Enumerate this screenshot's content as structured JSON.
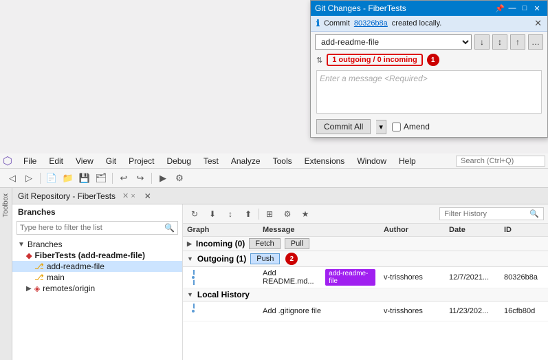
{
  "window": {
    "title": "Git Changes - FiberTests"
  },
  "git_changes": {
    "title": "Git Changes - FiberTests",
    "info_text": "Commit ",
    "commit_hash": "80326b8a",
    "info_suffix": " created locally.",
    "branch_name": "add-readme-file",
    "sync_label": "1 outgoing / 0 incoming",
    "message_placeholder": "Enter a message <Required>",
    "commit_all_label": "Commit All",
    "amend_label": "Amend",
    "badge_number": "1"
  },
  "menu": {
    "items": [
      "File",
      "Edit",
      "View",
      "Git",
      "Project",
      "Debug",
      "Test",
      "Analyze",
      "Tools",
      "Extensions",
      "Window",
      "Help"
    ],
    "search_placeholder": "Search (Ctrl+Q)"
  },
  "git_repo": {
    "title": "Git Repository - FiberTests"
  },
  "branches": {
    "header": "Branches",
    "search_placeholder": "Type here to filter the list",
    "tree": [
      {
        "label": "Branches",
        "level": 0,
        "icon": "expand",
        "bold": true
      },
      {
        "label": "FiberTests (add-readme-file)",
        "level": 1,
        "icon": "repo",
        "bold": true
      },
      {
        "label": "add-readme-file",
        "level": 2,
        "icon": "branch",
        "selected": true
      },
      {
        "label": "main",
        "level": 2,
        "icon": "branch"
      },
      {
        "label": "remotes/origin",
        "level": 1,
        "icon": "folder"
      }
    ]
  },
  "graph": {
    "columns": [
      "Graph",
      "Message",
      "Author",
      "Date",
      "ID"
    ],
    "filter_placeholder": "Filter History",
    "sections": [
      {
        "name": "Incoming",
        "count": 0,
        "actions": [
          "Fetch",
          "Pull"
        ]
      },
      {
        "name": "Outgoing",
        "count": 1,
        "actions": [
          "Push"
        ]
      }
    ],
    "outgoing_rows": [
      {
        "message": "Add README.md...",
        "tag": "add-readme-file",
        "author": "v-trisshores",
        "date": "12/7/2021...",
        "id": "80326b8a"
      }
    ],
    "local_history": {
      "name": "Local History",
      "rows": [
        {
          "message": "Add .gitignore file",
          "author": "v-trisshores",
          "date": "11/23/202...",
          "id": "16cfb80d"
        }
      ]
    }
  },
  "icons": {
    "expand": "▶",
    "collapse": "▼",
    "branch": "⎇",
    "fetch": "↓",
    "push": "↑",
    "sync": "⇅",
    "refresh": "↻",
    "filter": "⊞",
    "search": "🔍",
    "close": "✕",
    "pin": "📌",
    "minimize": "—",
    "maximize": "□",
    "chevron_down": "▾",
    "info": "ℹ"
  }
}
